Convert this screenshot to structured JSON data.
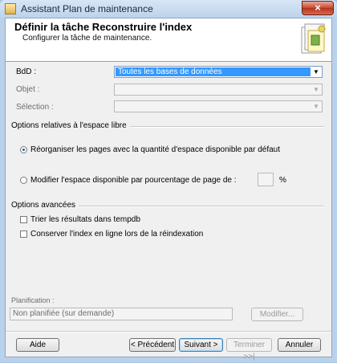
{
  "window": {
    "title": "Assistant Plan de maintenance"
  },
  "header": {
    "title": "Définir la tâche Reconstruire l'index",
    "subtitle": "Configurer la tâche de maintenance."
  },
  "fields": {
    "bdd": {
      "label": "BdD :",
      "value": "Toutes les bases de données"
    },
    "objet": {
      "label": "Objet :",
      "value": ""
    },
    "selection": {
      "label": "Sélection :",
      "value": ""
    }
  },
  "free_space": {
    "group_title": "Options relatives à l'espace libre",
    "option_reorganize": "Réorganiser les pages avec la quantité d'espace disponible par défaut",
    "option_modify": "Modifier l'espace disponible par pourcentage de page de :",
    "percent_value": "",
    "percent_unit": "%",
    "selected": "reorganize"
  },
  "advanced": {
    "group_title": "Options avancées",
    "sort_tempdb": {
      "label": "Trier les résultats dans tempdb",
      "checked": false
    },
    "online_index": {
      "label": "Conserver l'index en ligne lors de la réindexation",
      "checked": false
    }
  },
  "schedule": {
    "label": "Planification :",
    "value": "Non planifiée (sur demande)",
    "modify_button": "Modifier..."
  },
  "buttons": {
    "help": "Aide",
    "previous": "< Précédent",
    "next": "Suivant >",
    "finish": "Terminer >>|",
    "cancel": "Annuler"
  },
  "icons": {
    "app": "maintenance-plan-icon",
    "wizard": "wizard-task-icon",
    "dropdown": "chevron-down-icon"
  }
}
